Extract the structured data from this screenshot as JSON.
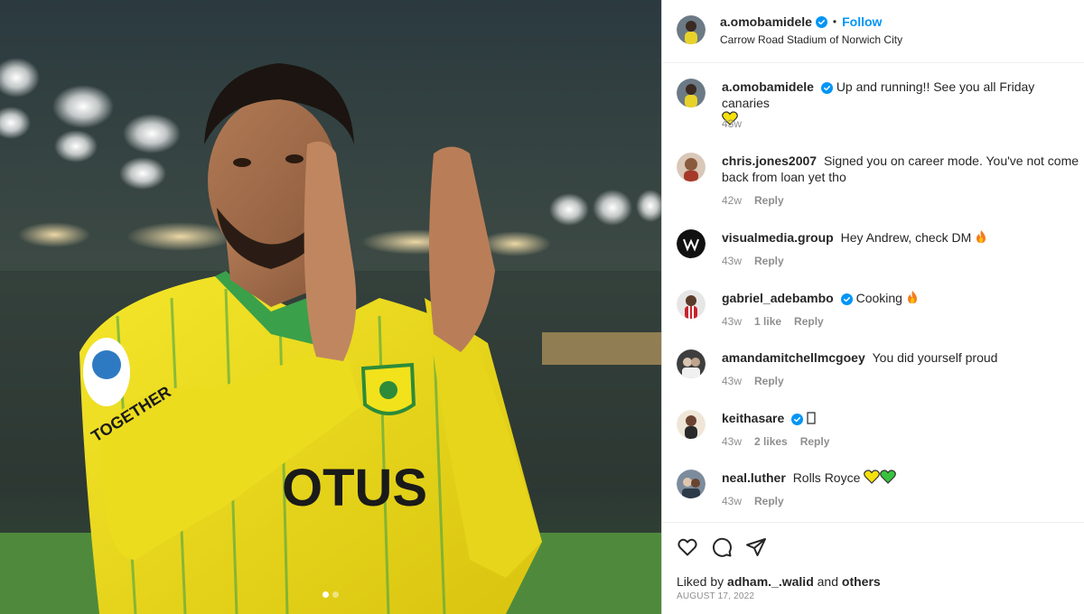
{
  "post": {
    "author": "a.omobamidele",
    "follow_label": "Follow",
    "separator": "•",
    "location": "Carrow Road Stadium of Norwich City"
  },
  "photo": {
    "shirt_text": "OTUS",
    "sleeve_text": "TOGETHER",
    "carousel_count": 2,
    "carousel_active": 0
  },
  "comments": [
    {
      "username": "a.omobamidele",
      "verified": true,
      "text": "Up and running!! See you all Friday canaries",
      "emoji": "yellow-heart",
      "time": "43w",
      "likes": "",
      "reply": "",
      "avatar_color": "#6b7a85"
    },
    {
      "username": "chris.jones2007",
      "verified": false,
      "text": "Signed you on career mode. You've not come back from loan yet tho",
      "emoji": "",
      "time": "42w",
      "likes": "",
      "reply": "Reply",
      "avatar_color": "#8a5a3c"
    },
    {
      "username": "visualmedia.group",
      "verified": false,
      "text": "Hey Andrew, check DM",
      "emoji": "fire",
      "time": "43w",
      "likes": "",
      "reply": "Reply",
      "avatar_color": "#111111"
    },
    {
      "username": "gabriel_adebambo",
      "verified": true,
      "text": "Cooking",
      "emoji": "fire",
      "time": "43w",
      "likes": "1 like",
      "reply": "Reply",
      "avatar_color": "#c9c9c9"
    },
    {
      "username": "amandamitchellmcgoey",
      "verified": false,
      "text": "You did yourself proud",
      "emoji": "",
      "time": "43w",
      "likes": "",
      "reply": "Reply",
      "avatar_color": "#4a4a4a"
    },
    {
      "username": "keithasare",
      "verified": true,
      "text": "",
      "emoji": "box",
      "time": "43w",
      "likes": "2 likes",
      "reply": "Reply",
      "avatar_color": "#b07a40"
    },
    {
      "username": "neal.luther",
      "verified": false,
      "text": "Rolls Royce",
      "emoji": "yellow-green-hearts",
      "time": "43w",
      "likes": "",
      "reply": "Reply",
      "avatar_color": "#5c6f82"
    }
  ],
  "footer": {
    "liked_prefix": "Liked by",
    "liked_user": "adham._.walid",
    "liked_and": "and",
    "liked_others": "others",
    "date": "AUGUST 17, 2022"
  },
  "icons": [
    "heart-icon",
    "comment-icon",
    "share-icon",
    "verified-badge-icon"
  ],
  "colors": {
    "accent": "#0095f6",
    "verified": "#0095f6",
    "shirt": "#f2e21b",
    "shirt_stripe": "#3aa04a",
    "meta_text": "#8e8e8e"
  }
}
